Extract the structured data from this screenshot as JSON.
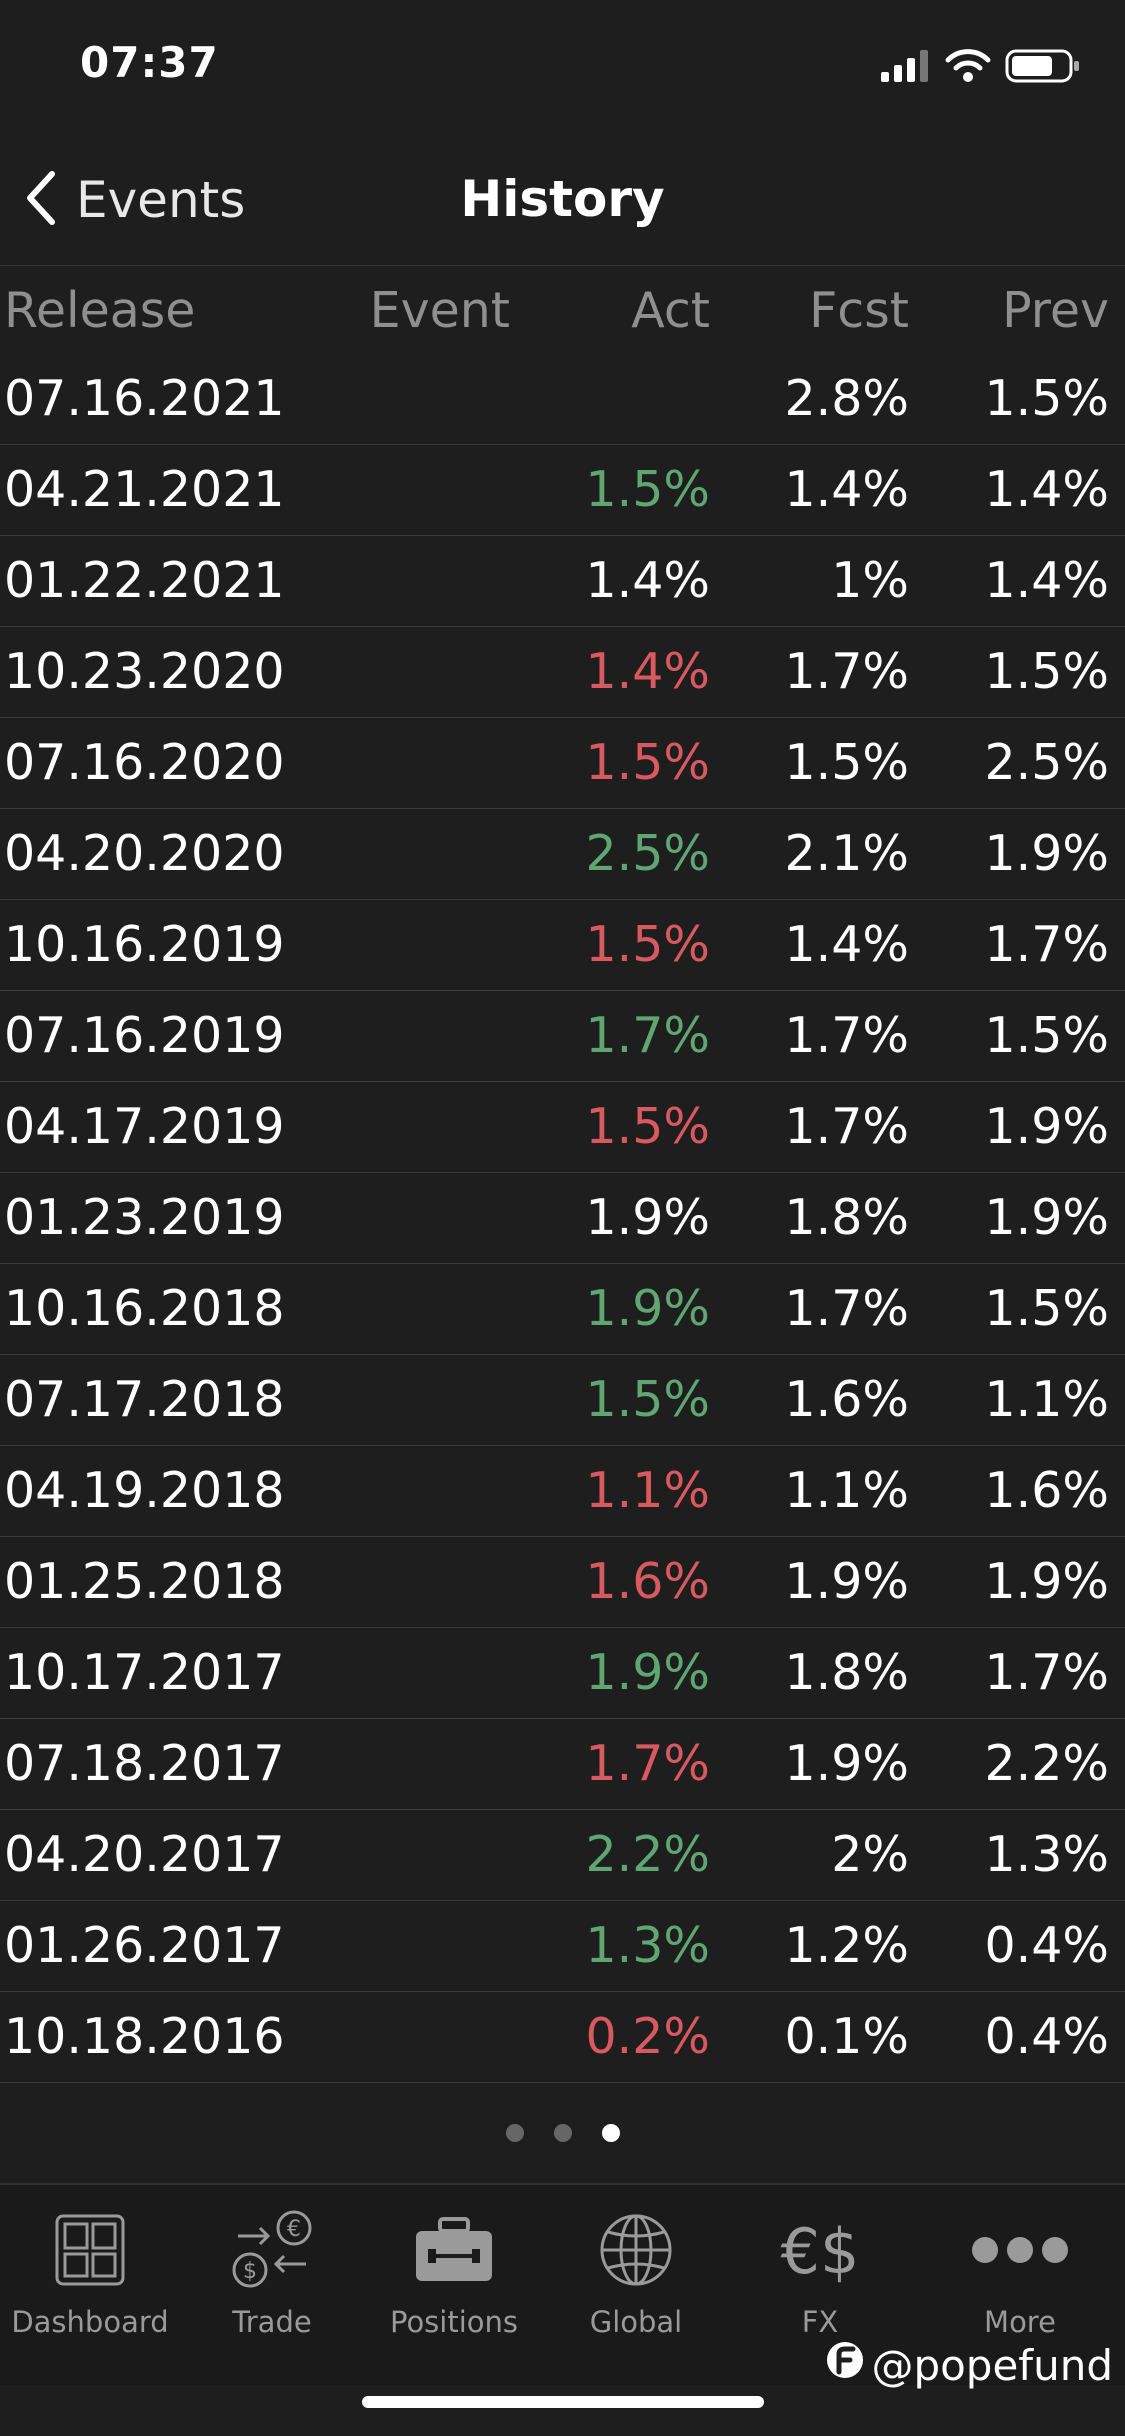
{
  "status_bar": {
    "time": "07:37",
    "icons": [
      "signal-icon",
      "wifi-icon",
      "battery-icon"
    ]
  },
  "nav": {
    "back_label": "Events",
    "title": "History"
  },
  "table": {
    "headers": {
      "release": "Release",
      "event": "Event",
      "act": "Act",
      "fcst": "Fcst",
      "prev": "Prev"
    },
    "rows": [
      {
        "release": "07.16.2021",
        "event": "",
        "act": "",
        "act_status": "neutral",
        "fcst": "2.8%",
        "prev": "1.5%"
      },
      {
        "release": "04.21.2021",
        "event": "",
        "act": "1.5%",
        "act_status": "positive",
        "fcst": "1.4%",
        "prev": "1.4%"
      },
      {
        "release": "01.22.2021",
        "event": "",
        "act": "1.4%",
        "act_status": "neutral",
        "fcst": "1%",
        "prev": "1.4%"
      },
      {
        "release": "10.23.2020",
        "event": "",
        "act": "1.4%",
        "act_status": "negative",
        "fcst": "1.7%",
        "prev": "1.5%"
      },
      {
        "release": "07.16.2020",
        "event": "",
        "act": "1.5%",
        "act_status": "negative",
        "fcst": "1.5%",
        "prev": "2.5%"
      },
      {
        "release": "04.20.2020",
        "event": "",
        "act": "2.5%",
        "act_status": "positive",
        "fcst": "2.1%",
        "prev": "1.9%"
      },
      {
        "release": "10.16.2019",
        "event": "",
        "act": "1.5%",
        "act_status": "negative",
        "fcst": "1.4%",
        "prev": "1.7%"
      },
      {
        "release": "07.16.2019",
        "event": "",
        "act": "1.7%",
        "act_status": "positive",
        "fcst": "1.7%",
        "prev": "1.5%"
      },
      {
        "release": "04.17.2019",
        "event": "",
        "act": "1.5%",
        "act_status": "negative",
        "fcst": "1.7%",
        "prev": "1.9%"
      },
      {
        "release": "01.23.2019",
        "event": "",
        "act": "1.9%",
        "act_status": "neutral",
        "fcst": "1.8%",
        "prev": "1.9%"
      },
      {
        "release": "10.16.2018",
        "event": "",
        "act": "1.9%",
        "act_status": "positive",
        "fcst": "1.7%",
        "prev": "1.5%"
      },
      {
        "release": "07.17.2018",
        "event": "",
        "act": "1.5%",
        "act_status": "positive",
        "fcst": "1.6%",
        "prev": "1.1%"
      },
      {
        "release": "04.19.2018",
        "event": "",
        "act": "1.1%",
        "act_status": "negative",
        "fcst": "1.1%",
        "prev": "1.6%"
      },
      {
        "release": "01.25.2018",
        "event": "",
        "act": "1.6%",
        "act_status": "negative",
        "fcst": "1.9%",
        "prev": "1.9%"
      },
      {
        "release": "10.17.2017",
        "event": "",
        "act": "1.9%",
        "act_status": "positive",
        "fcst": "1.8%",
        "prev": "1.7%"
      },
      {
        "release": "07.18.2017",
        "event": "",
        "act": "1.7%",
        "act_status": "negative",
        "fcst": "1.9%",
        "prev": "2.2%"
      },
      {
        "release": "04.20.2017",
        "event": "",
        "act": "2.2%",
        "act_status": "positive",
        "fcst": "2%",
        "prev": "1.3%"
      },
      {
        "release": "01.26.2017",
        "event": "",
        "act": "1.3%",
        "act_status": "positive",
        "fcst": "1.2%",
        "prev": "0.4%"
      },
      {
        "release": "10.18.2016",
        "event": "",
        "act": "0.2%",
        "act_status": "negative",
        "fcst": "0.1%",
        "prev": "0.4%"
      }
    ]
  },
  "pagination": {
    "total": 3,
    "active": 3
  },
  "tabbar": {
    "tabs": [
      {
        "label": "Dashboard",
        "icon": "dashboard-icon"
      },
      {
        "label": "Trade",
        "icon": "trade-icon"
      },
      {
        "label": "Positions",
        "icon": "briefcase-icon"
      },
      {
        "label": "Global",
        "icon": "globe-icon"
      },
      {
        "label": "FX",
        "icon": "fx-icon"
      },
      {
        "label": "More",
        "icon": "more-icon"
      }
    ]
  },
  "watermark": "@popefund",
  "colors": {
    "positive": "#5fa673",
    "negative": "#d8595f",
    "neutral": "#ffffff",
    "background": "#1e1e1e"
  }
}
